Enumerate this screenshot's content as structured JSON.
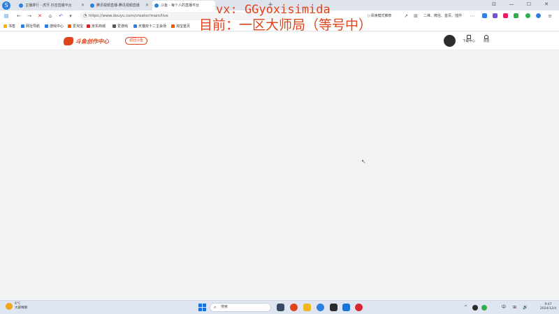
{
  "overlay": {
    "line1": "vx: GGyoxisimida",
    "line2": "目前：一区大师局（等号中）"
  },
  "browser": {
    "tabs": [
      {
        "label": "主播排行 - 虎牙 抖音直播平台"
      },
      {
        "label": "腾讯视频直播-腾讯视频直播"
      },
      {
        "label": "斗鱼 - 每个人的直播平台",
        "active": true
      }
    ],
    "new_tab": "+",
    "address": "https://www.douyu.com/creator/main/live",
    "toolbar_right": [
      "阅读模式推荐",
      "二维、微信、首页、插件"
    ],
    "window_controls": [
      "⊡",
      "—",
      "☐",
      "✕"
    ]
  },
  "bookmarks": [
    {
      "label": "书签",
      "color": "#f5b400"
    },
    {
      "label": "网址导航",
      "color": "#2f7fe0"
    },
    {
      "label": "游戏中心",
      "color": "#2f7fe0"
    },
    {
      "label": "爱淘宝",
      "color": "#f25a00"
    },
    {
      "label": "京东商城",
      "color": "#d8262d"
    },
    {
      "label": "爱游戏",
      "color": "#555555"
    },
    {
      "label": "天猫双十二主会场",
      "color": "#2f7fe0"
    },
    {
      "label": "淘宝首页",
      "color": "#f25a00"
    }
  ],
  "site": {
    "logo_text": "斗鱼创作中心",
    "back_pill": "返回斗鱼",
    "header_icons": [
      {
        "icon": "upload-icon",
        "label": "下载中心"
      },
      {
        "icon": "bell-icon",
        "label": "消息"
      }
    ]
  },
  "taskbar": {
    "weather_temp": "6°C",
    "weather_desc": "大部晴朗",
    "search_placeholder": "搜索",
    "tray_items": [
      "^",
      "中",
      "⊞",
      "🔊"
    ],
    "clock_time": "9:47",
    "clock_date": "2024/12/4"
  },
  "colors": {
    "accent": "#e0441c",
    "page_bg": "#f2f3f5"
  }
}
